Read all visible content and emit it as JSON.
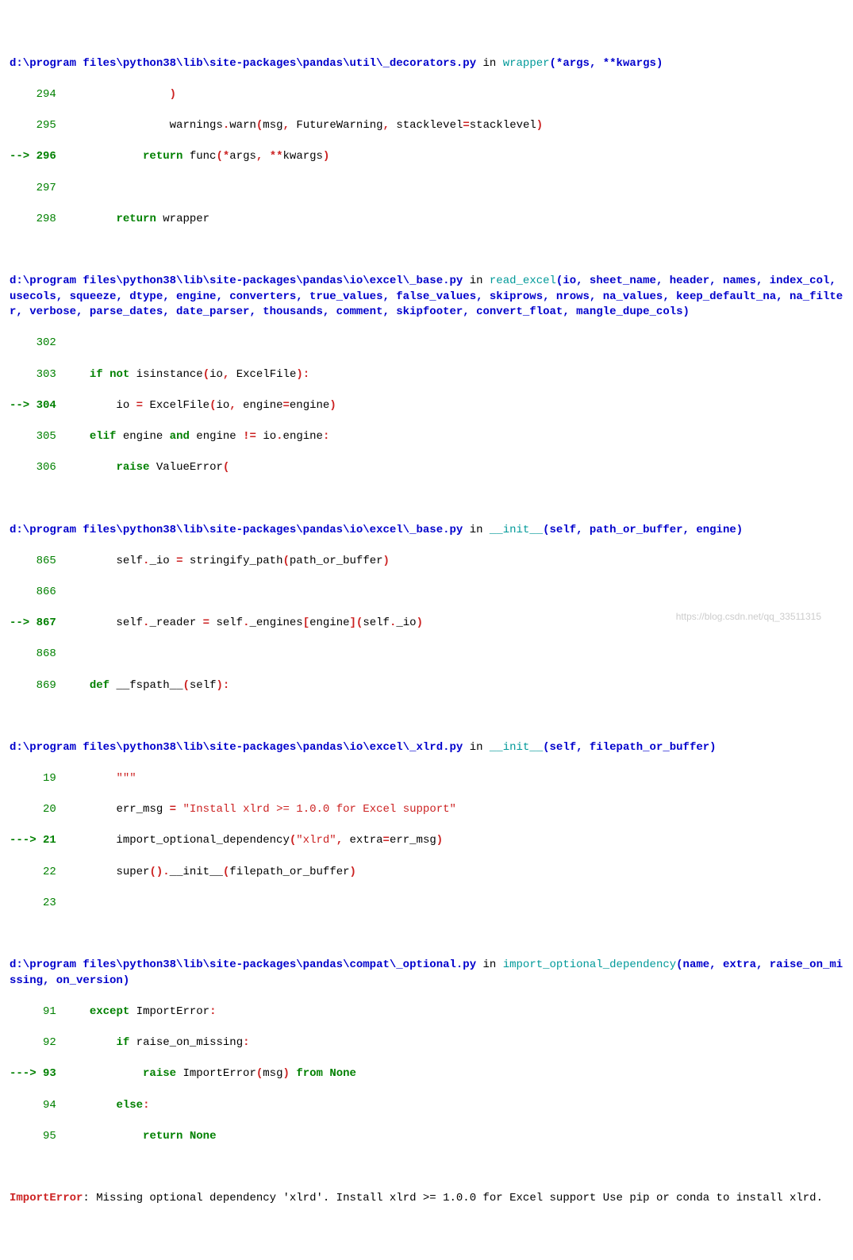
{
  "frames": [
    {
      "path": "d:\\program files\\python38\\lib\\site-packages\\pandas\\util\\_decorators.py",
      "func": "wrapper",
      "sig": "(*args, **kwargs)",
      "lines": [
        {
          "n": "294",
          "arrow": false,
          "raw": "                )"
        },
        {
          "n": "295",
          "arrow": false,
          "raw": "                warnings.warn(msg, FutureWarning, stacklevel=stacklevel)"
        },
        {
          "n": "296",
          "arrow": true,
          "raw": "            return func(*args, **kwargs)"
        },
        {
          "n": "297",
          "arrow": false,
          "raw": ""
        },
        {
          "n": "298",
          "arrow": false,
          "raw": "        return wrapper"
        }
      ]
    },
    {
      "path": "d:\\program files\\python38\\lib\\site-packages\\pandas\\io\\excel\\_base.py",
      "func": "read_excel",
      "sig": "(io, sheet_name, header, names, index_col, usecols, squeeze, dtype, engine, converters, true_values, false_values, skiprows, nrows, na_values, keep_default_na, na_filter, verbose, parse_dates, date_parser, thousands, comment, skipfooter, convert_float, mangle_dupe_cols)",
      "lines": [
        {
          "n": "302",
          "arrow": false,
          "raw": ""
        },
        {
          "n": "303",
          "arrow": false,
          "raw": "    if not isinstance(io, ExcelFile):"
        },
        {
          "n": "304",
          "arrow": true,
          "raw": "        io = ExcelFile(io, engine=engine)"
        },
        {
          "n": "305",
          "arrow": false,
          "raw": "    elif engine and engine != io.engine:"
        },
        {
          "n": "306",
          "arrow": false,
          "raw": "        raise ValueError("
        }
      ]
    },
    {
      "path": "d:\\program files\\python38\\lib\\site-packages\\pandas\\io\\excel\\_base.py",
      "func": "__init__",
      "sig": "(self, path_or_buffer, engine)",
      "lines": [
        {
          "n": "865",
          "arrow": false,
          "raw": "        self._io = stringify_path(path_or_buffer)"
        },
        {
          "n": "866",
          "arrow": false,
          "raw": ""
        },
        {
          "n": "867",
          "arrow": true,
          "raw": "        self._reader = self._engines[engine](self._io)"
        },
        {
          "n": "868",
          "arrow": false,
          "raw": ""
        },
        {
          "n": "869",
          "arrow": false,
          "raw": "    def __fspath__(self):"
        }
      ]
    },
    {
      "path": "d:\\program files\\python38\\lib\\site-packages\\pandas\\io\\excel\\_xlrd.py",
      "func": "__init__",
      "sig": "(self, filepath_or_buffer)",
      "lines": [
        {
          "n": "19",
          "arrow": false,
          "raw": "        \"\"\""
        },
        {
          "n": "20",
          "arrow": false,
          "raw": "        err_msg = \"Install xlrd >= 1.0.0 for Excel support\""
        },
        {
          "n": "21",
          "arrow": true,
          "raw": "        import_optional_dependency(\"xlrd\", extra=err_msg)"
        },
        {
          "n": "22",
          "arrow": false,
          "raw": "        super().__init__(filepath_or_buffer)"
        },
        {
          "n": "23",
          "arrow": false,
          "raw": ""
        }
      ]
    },
    {
      "path": "d:\\program files\\python38\\lib\\site-packages\\pandas\\compat\\_optional.py",
      "func": "import_optional_dependency",
      "sig": "(name, extra, raise_on_missing, on_version)",
      "lines": [
        {
          "n": "91",
          "arrow": false,
          "raw": "    except ImportError:"
        },
        {
          "n": "92",
          "arrow": false,
          "raw": "        if raise_on_missing:"
        },
        {
          "n": "93",
          "arrow": true,
          "raw": "            raise ImportError(msg) from None"
        },
        {
          "n": "94",
          "arrow": false,
          "raw": "        else:"
        },
        {
          "n": "95",
          "arrow": false,
          "raw": "            return None"
        }
      ]
    }
  ],
  "error": {
    "type": "ImportError",
    "msg": ": Missing optional dependency 'xlrd'. Install xlrd >= 1.0.0 for Excel support Use pip or conda to install xlrd."
  },
  "watermark": "https://blog.csdn.net/qq_33511315"
}
